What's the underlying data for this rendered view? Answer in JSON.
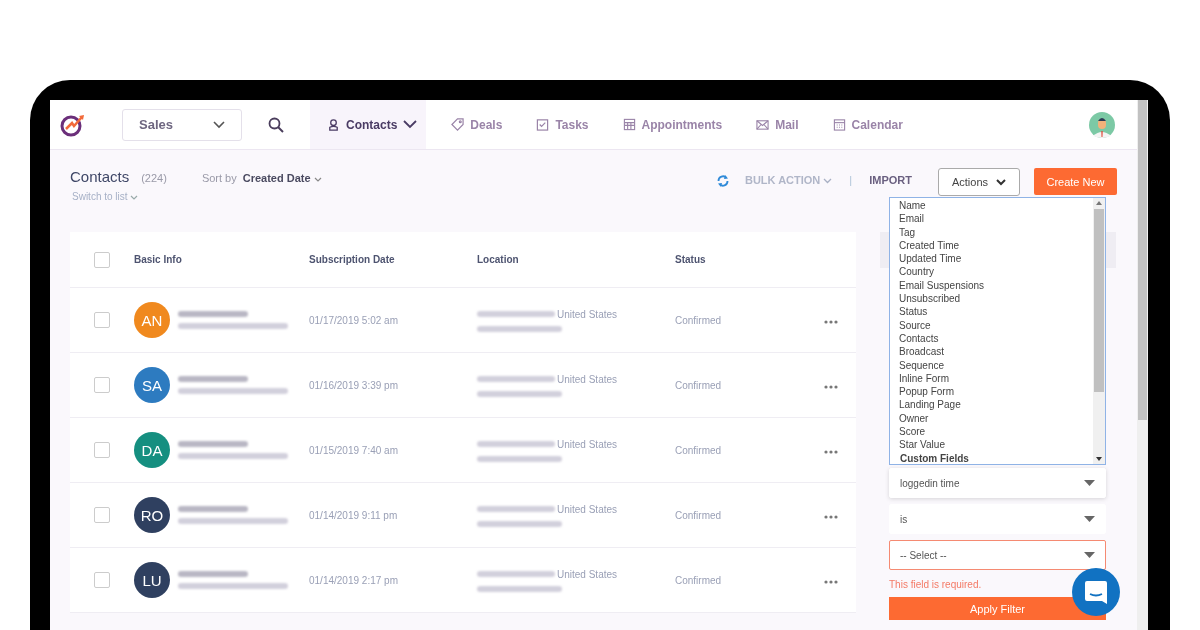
{
  "nav": {
    "workspace": "Sales",
    "tabs": [
      {
        "label": "Contacts",
        "kind": "person",
        "selected": true
      },
      {
        "label": "Deals",
        "kind": "tag",
        "selected": false
      },
      {
        "label": "Tasks",
        "kind": "task",
        "selected": false
      },
      {
        "label": "Appointments",
        "kind": "grid",
        "selected": false
      },
      {
        "label": "Mail",
        "kind": "mail",
        "selected": false
      },
      {
        "label": "Calendar",
        "kind": "calendar",
        "selected": false
      }
    ]
  },
  "header": {
    "title": "Contacts",
    "count": "(224)",
    "sort_label": "Sort by",
    "sort_value": "Created Date",
    "switch": "Switch to list",
    "bulk_action": "BULK ACTION",
    "separator": "|",
    "import": "IMPORT",
    "actions": "Actions",
    "create": "Create New"
  },
  "table": {
    "columns": [
      "Basic Info",
      "Subscription Date",
      "Location",
      "Status"
    ],
    "all_checked": false,
    "rows": [
      {
        "initials": "AN",
        "color": "#f0891e",
        "date": "01/17/2019 5:02 am",
        "location": "United States",
        "status": "Confirmed",
        "checked": false
      },
      {
        "initials": "SA",
        "color": "#2d7bc0",
        "date": "01/16/2019 3:39 pm",
        "location": "United States",
        "status": "Confirmed",
        "checked": false
      },
      {
        "initials": "DA",
        "color": "#158f80",
        "date": "01/15/2019 7:40 am",
        "location": "United States",
        "status": "Confirmed",
        "checked": false
      },
      {
        "initials": "RO",
        "color": "#2f4060",
        "date": "01/14/2019 9:11 pm",
        "location": "United States",
        "status": "Confirmed",
        "checked": false
      },
      {
        "initials": "LU",
        "color": "#2f4060",
        "date": "01/14/2019 2:17 pm",
        "location": "United States",
        "status": "Confirmed",
        "checked": false
      }
    ]
  },
  "filter": {
    "options": [
      {
        "label": "Name",
        "kind": "option"
      },
      {
        "label": "Email",
        "kind": "option"
      },
      {
        "label": "Tag",
        "kind": "option"
      },
      {
        "label": "Created Time",
        "kind": "option"
      },
      {
        "label": "Updated Time",
        "kind": "option"
      },
      {
        "label": "Country",
        "kind": "option"
      },
      {
        "label": "Email Suspensions",
        "kind": "option"
      },
      {
        "label": "Unsubscribed",
        "kind": "option"
      },
      {
        "label": "Status",
        "kind": "option"
      },
      {
        "label": "Source",
        "kind": "option"
      },
      {
        "label": "Contacts",
        "kind": "option"
      },
      {
        "label": "Broadcast",
        "kind": "option"
      },
      {
        "label": "Sequence",
        "kind": "option"
      },
      {
        "label": "Inline Form",
        "kind": "option"
      },
      {
        "label": "Popup Form",
        "kind": "option"
      },
      {
        "label": "Landing Page",
        "kind": "option"
      },
      {
        "label": "Owner",
        "kind": "option"
      },
      {
        "label": "Score",
        "kind": "option"
      },
      {
        "label": "Star Value",
        "kind": "option"
      },
      {
        "label": "Custom Fields",
        "kind": "group"
      }
    ],
    "selects": [
      {
        "value": "loggedin time",
        "error": false
      },
      {
        "value": "is",
        "error": false
      },
      {
        "placeholder": "-- Select --",
        "error": true
      }
    ],
    "error_text": "This field is required.",
    "apply": "Apply Filter"
  }
}
